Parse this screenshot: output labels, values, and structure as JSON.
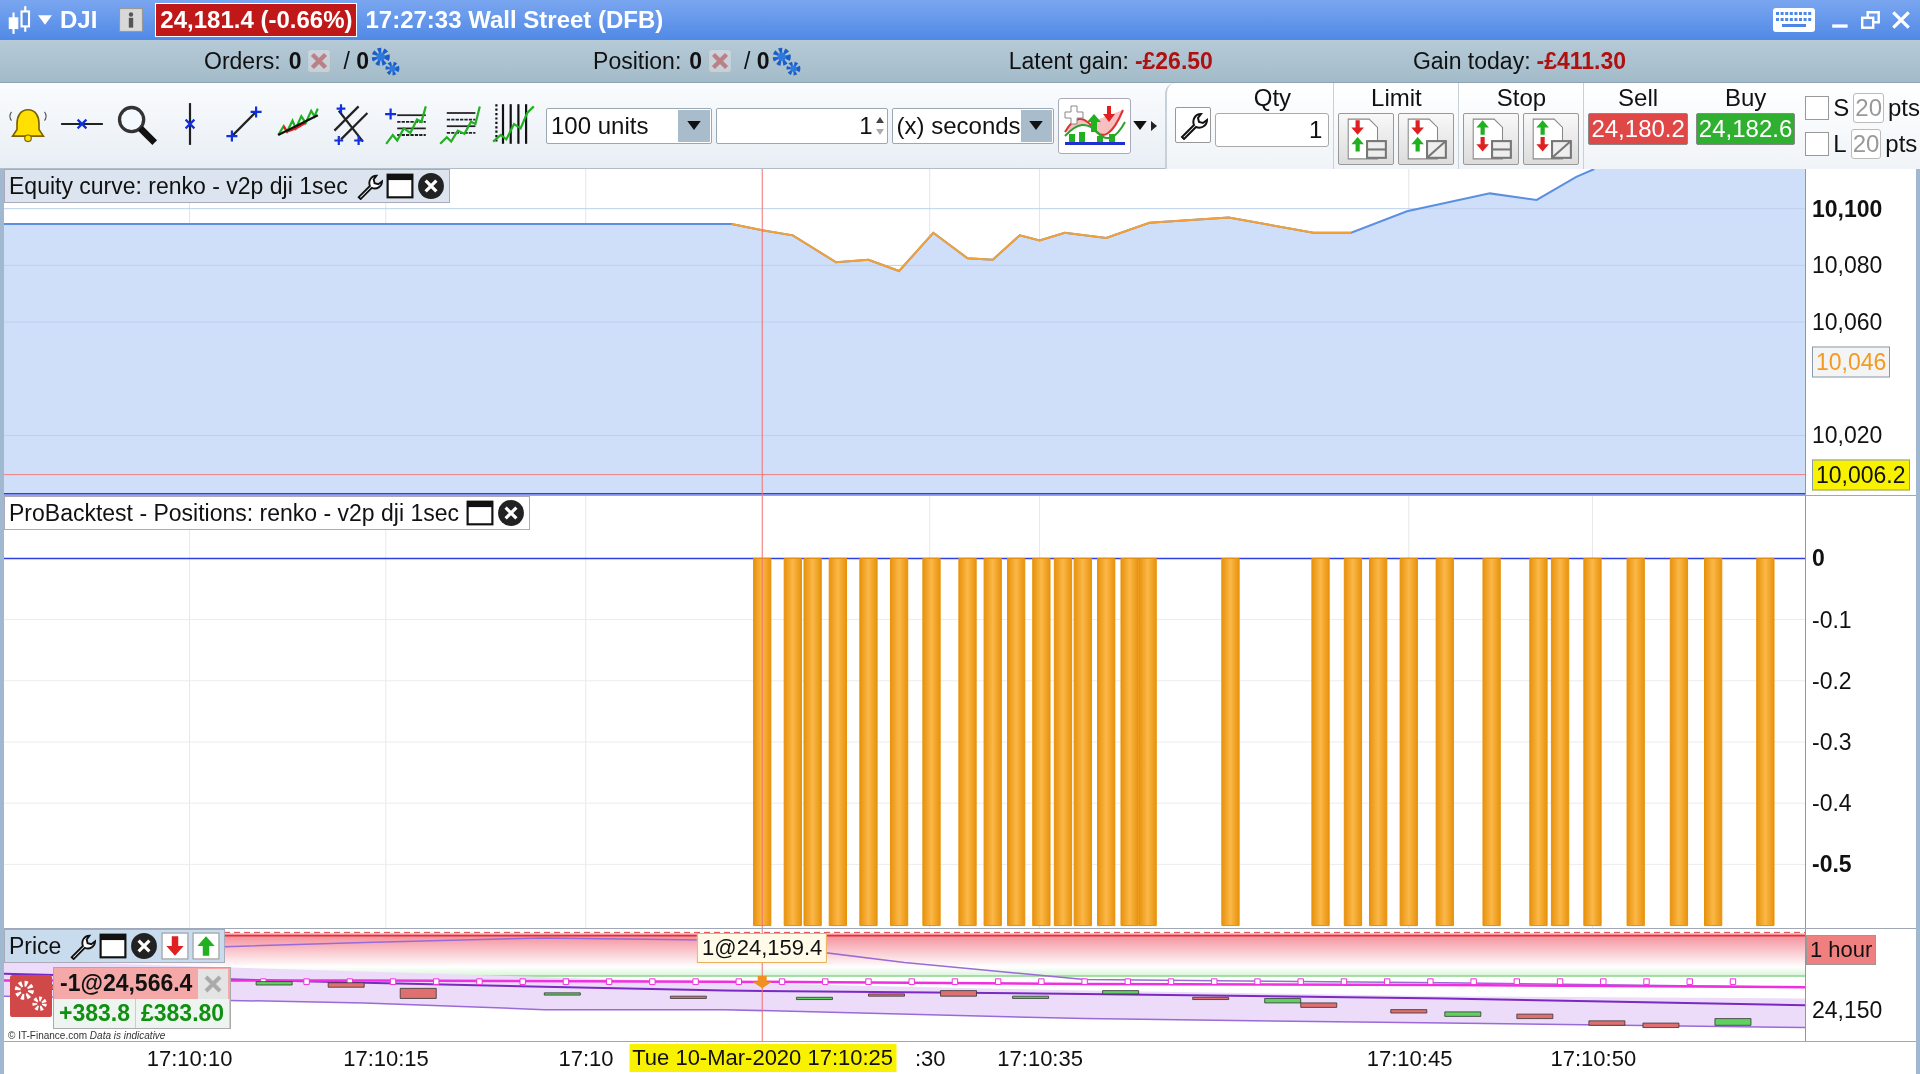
{
  "title_bar": {
    "instrument": "DJI",
    "quote": "24,181.4 (-0.66%)",
    "description": "17:27:33 Wall Street (DFB)"
  },
  "info_bar": {
    "orders": {
      "label": "Orders:",
      "count": "0",
      "pending": "/ **0**",
      "disabled": true
    },
    "position": {
      "label": "Position:",
      "count": "0",
      "pending": "/ **0**",
      "disabled": true
    },
    "latent_gain": {
      "label": "Latent gain:",
      "value": "-£26.50"
    },
    "gain_today": {
      "label": "Gain today:",
      "value": "-£411.30"
    }
  },
  "toolbar": {
    "units": "100 units",
    "interval_count": "1",
    "interval_unit": "(x) seconds"
  },
  "order_panel": {
    "qty": {
      "label": "Qty",
      "value": "1"
    },
    "limit": {
      "label": "Limit"
    },
    "stop": {
      "label": "Stop"
    },
    "sell": {
      "label": "Sell",
      "price": "24,180.2"
    },
    "buy": {
      "label": "Buy",
      "price": "24,182.6"
    },
    "protections": [
      {
        "label": "S",
        "points": "20",
        "unit": "pts",
        "checked": false
      },
      {
        "label": "L",
        "points": "20",
        "unit": "pts",
        "checked": false
      }
    ]
  },
  "chart": {
    "date_label": "Tue 10-Mar-2020 17:10:25",
    "equity": {
      "title": "Equity curve: renko - v2p dji 1sec",
      "axis_labels": [
        "10,100",
        "10,080",
        "10,060",
        "10,020"
      ],
      "markers": [
        {
          "kind": "current",
          "label": "10,046"
        },
        {
          "kind": "level",
          "label": "10,006.2"
        }
      ]
    },
    "positions": {
      "title": "ProBacktest - Positions: renko - v2p dji 1sec",
      "axis_labels": [
        "0",
        "-0.1",
        "-0.2",
        "-0.3",
        "-0.4",
        "-0.5"
      ]
    },
    "price": {
      "title": "Price",
      "tooltip": "1@24,159.4",
      "interval": "1 hour",
      "axis_labels": [
        "24,150"
      ],
      "order": {
        "label": "-1@24,566.4",
        "points": "+383.8",
        "amount": "£383.80"
      },
      "copyright": "© IT-Finance.com *Data is indicative*"
    },
    "time_axis": [
      "17:10:10",
      "17:10:15",
      "17:10",
      ":30",
      "17:10:35",
      "17:10:45",
      "17:10:50"
    ]
  }
}
